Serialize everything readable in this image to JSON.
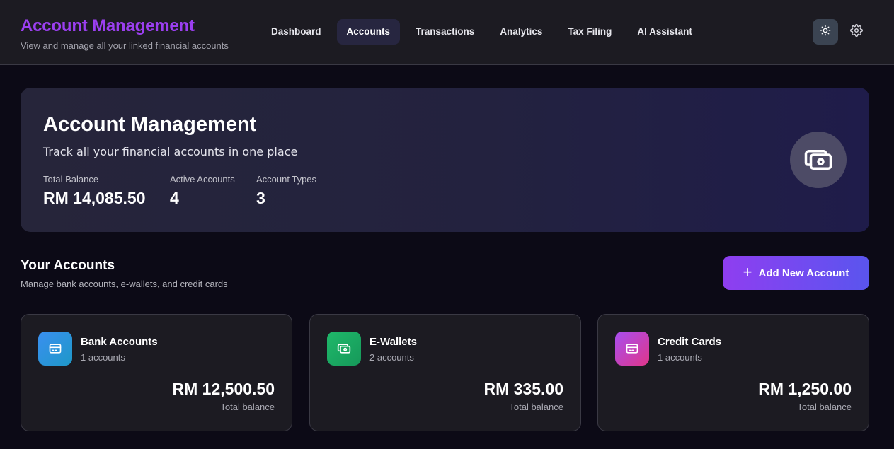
{
  "header": {
    "title": "Account Management",
    "subtitle": "View and manage all your linked financial accounts",
    "nav": [
      {
        "label": "Dashboard",
        "active": false
      },
      {
        "label": "Accounts",
        "active": true
      },
      {
        "label": "Transactions",
        "active": false
      },
      {
        "label": "Analytics",
        "active": false
      },
      {
        "label": "Tax Filing",
        "active": false
      },
      {
        "label": "AI Assistant",
        "active": false
      }
    ],
    "theme_icon": "sun-icon",
    "settings_icon": "gear-icon"
  },
  "hero": {
    "title": "Account Management",
    "subtitle": "Track all your financial accounts in one place",
    "stats": [
      {
        "label": "Total Balance",
        "value": "RM 14,085.50"
      },
      {
        "label": "Active Accounts",
        "value": "4"
      },
      {
        "label": "Account Types",
        "value": "3"
      }
    ],
    "icon": "wallet-cash-icon"
  },
  "section": {
    "title": "Your Accounts",
    "subtitle": "Manage bank accounts, e-wallets, and credit cards",
    "add_button": "Add New Account"
  },
  "cards": [
    {
      "name": "Bank Accounts",
      "count": "1 accounts",
      "amount": "RM 12,500.50",
      "amount_label": "Total balance",
      "icon": "credit-card-icon",
      "colors": [
        "#3a8ff0",
        "#1e98c8"
      ]
    },
    {
      "name": "E-Wallets",
      "count": "2 accounts",
      "amount": "RM 335.00",
      "amount_label": "Total balance",
      "icon": "cash-icon",
      "colors": [
        "#1fb86a",
        "#16995a"
      ]
    },
    {
      "name": "Credit Cards",
      "count": "1 accounts",
      "amount": "RM 1,250.00",
      "amount_label": "Total balance",
      "icon": "credit-card-icon",
      "colors": [
        "#a74ef0",
        "#e0368a"
      ]
    }
  ],
  "colors": {
    "accent": "#9b3ff0",
    "background": "#0c0a16",
    "panel": "#1c1b22"
  }
}
